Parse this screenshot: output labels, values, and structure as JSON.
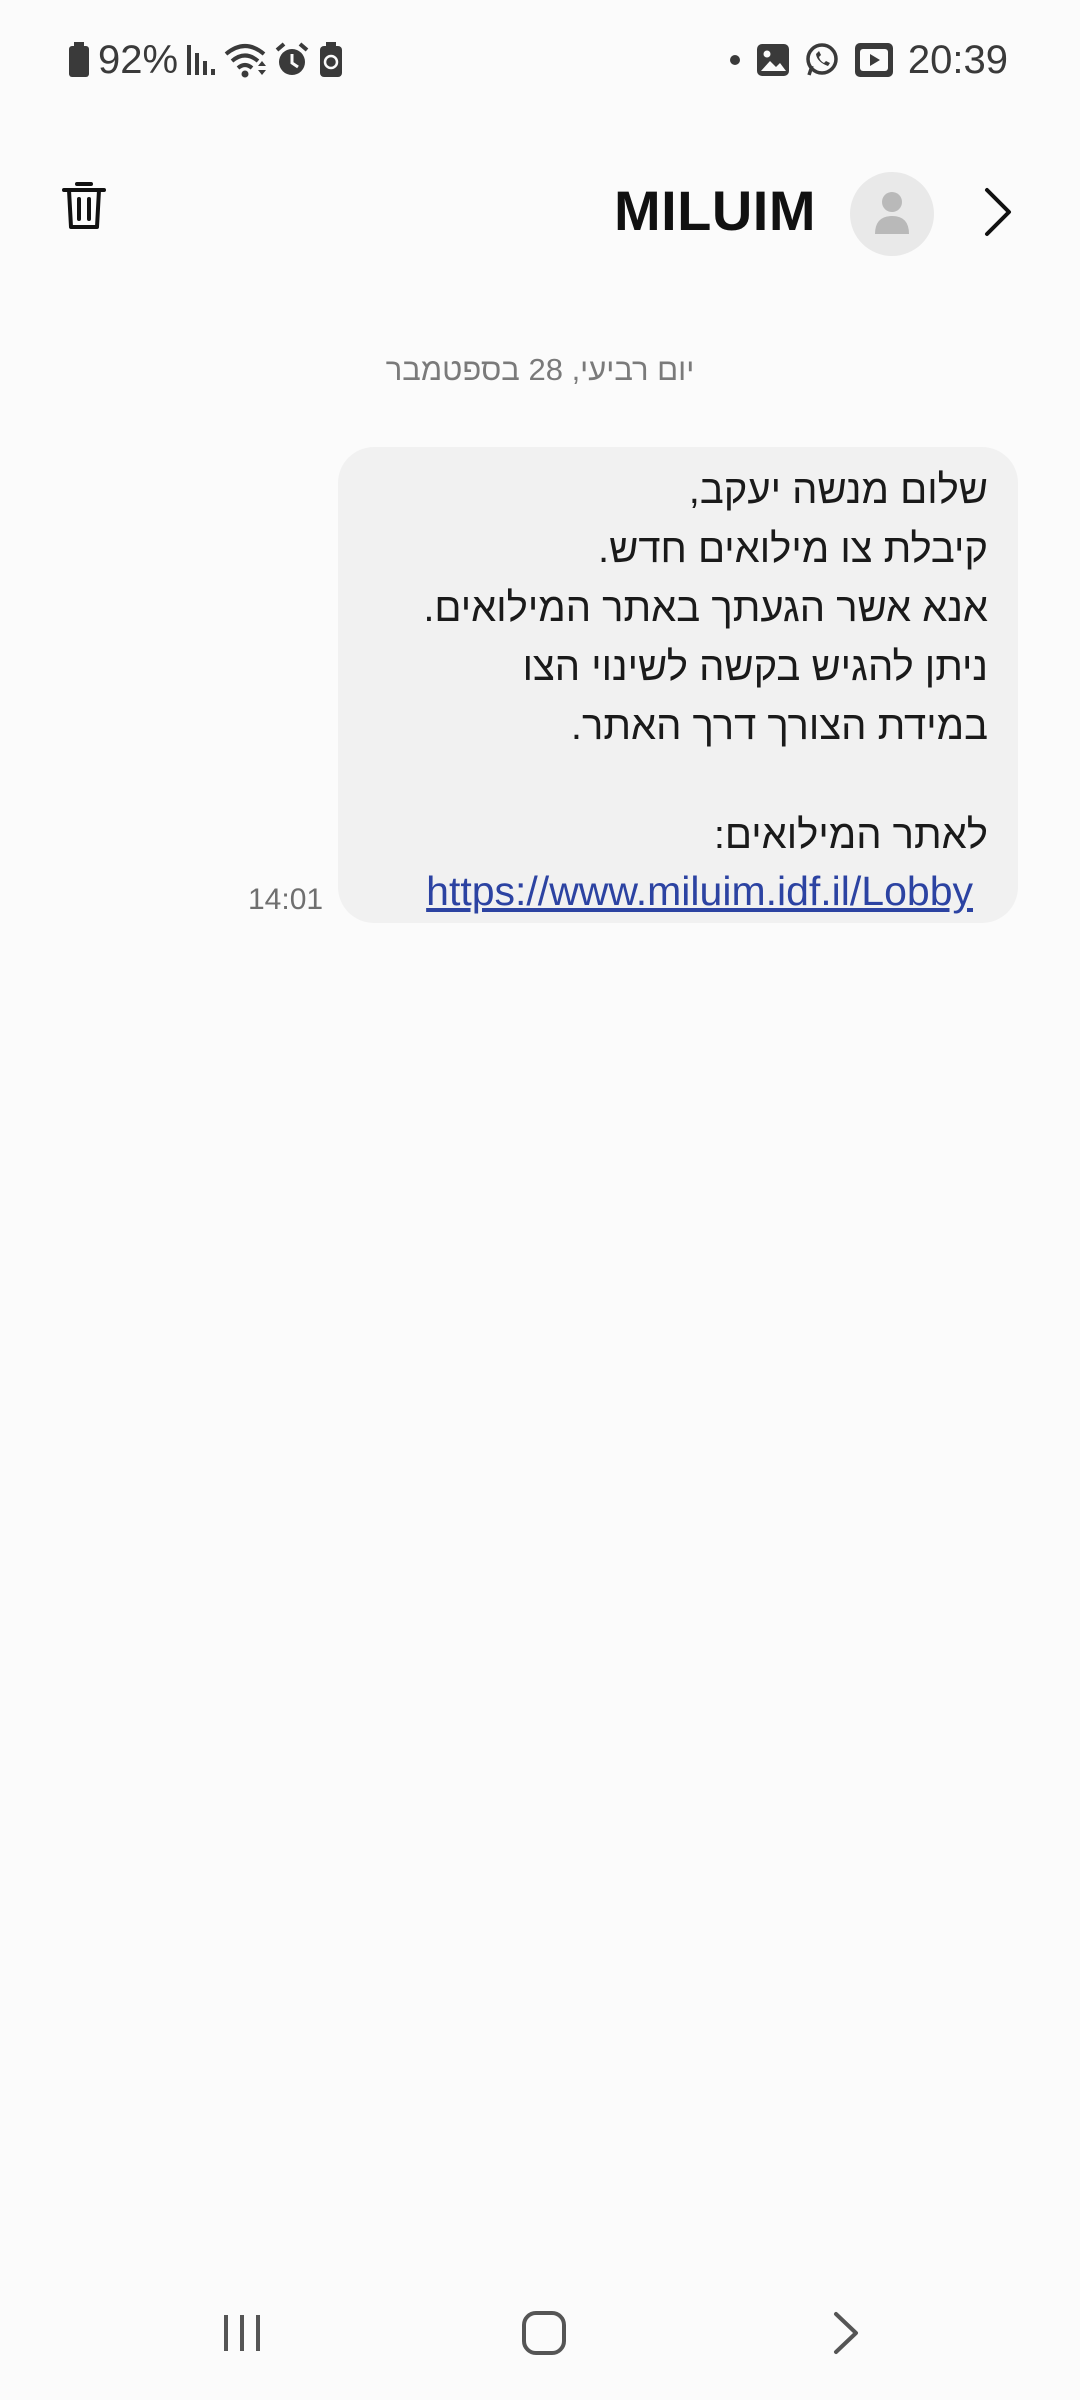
{
  "status_bar": {
    "battery_percent": "92%",
    "time": "20:39",
    "left_icons": [
      "battery-icon",
      "signal-icon",
      "wifi-icon",
      "alarm-icon",
      "battery-saver-icon"
    ],
    "right_icons": [
      "notification-dot-icon",
      "gallery-icon",
      "whatsapp-icon",
      "youtube-icon"
    ]
  },
  "header": {
    "title": "MILUIM",
    "icons": [
      "trash-icon",
      "contact-avatar-icon",
      "chevron-right-icon"
    ]
  },
  "conversation": {
    "date_divider": "יום רביעי, 28 בספטמבר",
    "messages": [
      {
        "lines": [
          "שלום מנשה יעקב,",
          "קיבלת צו מילואים חדש.",
          "אנא אשר הגעתך באתר המילואים.",
          "ניתן להגיש בקשה לשינוי הצו",
          "במידת הצורך דרך האתר."
        ],
        "link_intro": "לאתר המילואים:",
        "link": "https://www.miluim.idf.il/Lobby",
        "time": "14:01"
      }
    ]
  },
  "nav_bar": {
    "icons": [
      "recents-icon",
      "home-icon",
      "back-icon"
    ]
  },
  "colors": {
    "background": "#fbfbfb",
    "bubble": "#f1f1f1",
    "link": "#2c43a2",
    "secondary_text": "#7a7a7a"
  }
}
